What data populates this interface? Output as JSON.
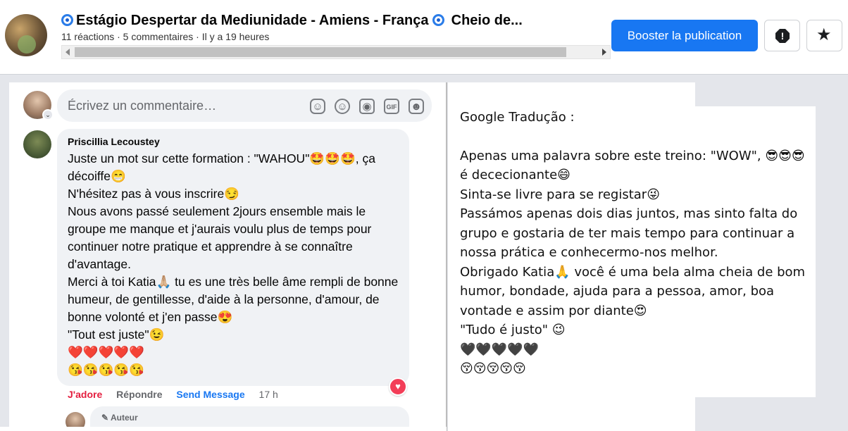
{
  "header": {
    "title": "Estágio Despertar da Mediunidade - Amiens - França",
    "title_suffix": "Cheio de...",
    "meta": "11 réactions · 5 commentaires · Il y a 19 heures",
    "boost_label": "Booster la publication"
  },
  "composer": {
    "placeholder": "Écrivez un commentaire…",
    "icons": [
      "avatar-sticker-icon",
      "emoji-icon",
      "camera-icon",
      "gif-icon",
      "sticker-icon"
    ]
  },
  "comment": {
    "author": "Priscillia Lecoustey",
    "lines": [
      "Juste un mot sur cette formation : \"WAHOU\"🤩🤩🤩, ça décoiffe😁",
      "N'hésitez pas à vous inscrire😏",
      "Nous avons passé seulement 2jours ensemble mais le groupe me manque et j'aurais voulu plus de temps pour continuer notre pratique et apprendre à se connaître d'avantage.",
      "Merci à toi Katia🙏🏼 tu es une très belle âme rempli de bonne humeur, de gentillesse, d'aide à la personne, d'amour, de bonne volonté et j'en passe😍",
      "\"Tout est juste\"😉",
      "❤️❤️❤️❤️❤️",
      "😘😘😘😘😘"
    ],
    "actions": {
      "like": "J'adore",
      "reply": "Répondre",
      "send": "Send Message",
      "time": "17 h"
    }
  },
  "reply_preview": {
    "badge": "Auteur"
  },
  "translation": {
    "title": "Google Tradução :",
    "lines": [
      "Apenas uma palavra sobre este treino: \"WOW\", 😎😎😎 é dececionante😄",
      "Sinta-se livre para se registar😜",
      "Passámos apenas dois dias juntos, mas sinto falta do grupo e gostaria de ter mais tempo para continuar a nossa prática e conhecermo-nos melhor.",
      "Obrigado Katia🙏 você é uma bela alma cheia de bom humor, bondade, ajuda para a pessoa, amor, boa vontade e assim por diante😍",
      "\"Tudo é justo\" 😉",
      "🖤🖤🖤🖤🖤",
      "😚😚😚😚😚"
    ]
  },
  "colors": {
    "brand_blue": "#1877f2",
    "like_red": "#e41e3f",
    "bubble_gray": "#f0f2f5"
  }
}
